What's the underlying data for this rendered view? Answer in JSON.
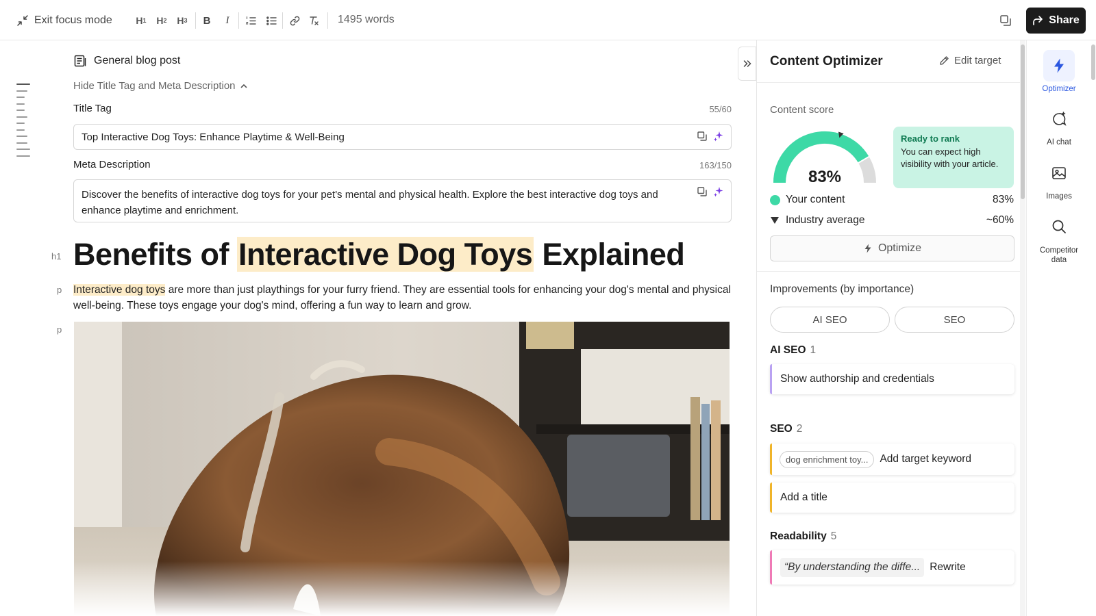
{
  "toolbar": {
    "exit_focus": "Exit focus mode",
    "word_count": "1495 words",
    "share": "Share"
  },
  "editor": {
    "doc_type": "General blog post",
    "hide_meta": "Hide Title Tag and Meta Description",
    "title_tag": {
      "label": "Title Tag",
      "count": "55/60",
      "value": "Top Interactive Dog Toys: Enhance Playtime & Well-Being"
    },
    "meta_description": {
      "label": "Meta Description",
      "count": "163/150",
      "value": "Discover the benefits of interactive dog toys for your pet's mental and physical health. Explore the best interactive dog toys and enhance playtime and enrichment."
    },
    "h1_tag": "h1",
    "p_tag": "p",
    "heading": {
      "before": "Benefits of ",
      "highlight": "Interactive Dog Toys",
      "after": " Explained"
    },
    "paragraph": {
      "highlight": "Interactive dog toys",
      "rest": " are more than just playthings for your furry friend. They are essential tools for enhancing your dog's mental and physical well-being. These toys engage your dog's mind, offering a fun way to learn and grow."
    }
  },
  "optimizer": {
    "title": "Content Optimizer",
    "edit_target": "Edit target",
    "content_score_label": "Content score",
    "score": "83%",
    "score_fraction": 0.83,
    "industry_fraction": 0.6,
    "rank_title": "Ready to rank",
    "rank_text": "You can expect high visibility with your article.",
    "your_content_label": "Your content",
    "your_content_value": "83%",
    "industry_label": "Industry average",
    "industry_value": "~60%",
    "optimize": "Optimize",
    "improvements_label": "Improvements (by importance)",
    "tabs": [
      "AI SEO",
      "SEO"
    ],
    "sections": {
      "ai_seo": {
        "title": "AI SEO",
        "count": "1",
        "items": [
          "Show authorship and credentials"
        ]
      },
      "seo": {
        "title": "SEO",
        "count": "2",
        "keyword_chip": "dog enrichment toy...",
        "items": [
          "Add target keyword",
          "Add a title"
        ]
      },
      "readability": {
        "title": "Readability",
        "count": "5",
        "quote": "“By understanding the diffe...",
        "action": "Rewrite"
      }
    },
    "colors": {
      "accent_green": "#3dd9a6",
      "ai_seo_purple": "#b9a2f2",
      "seo_amber": "#f0b429",
      "readability_pink": "#ef7ab6",
      "active_blue": "#2b57e0"
    }
  },
  "rail": {
    "items": [
      {
        "label": "Optimizer",
        "icon": "bolt-icon"
      },
      {
        "label": "AI chat",
        "icon": "chat-icon"
      },
      {
        "label": "Images",
        "icon": "image-icon"
      },
      {
        "label": "Competitor data",
        "icon": "search-icon"
      }
    ]
  }
}
